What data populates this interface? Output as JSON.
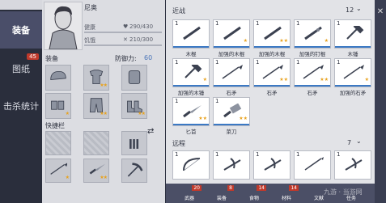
{
  "nav": {
    "equip_label": "装备",
    "blueprint_label": "图纸",
    "blueprint_badge": "45",
    "kills_label": "击杀统计"
  },
  "character": {
    "name": "尼奥",
    "hp_label": "健康",
    "hp_value": "290/430",
    "hunger_label": "饥饿",
    "hunger_value": "210/300",
    "equip_label": "装备",
    "defense_label": "防御力:",
    "defense_value": "60",
    "quickbar_label": "快捷栏"
  },
  "equip_slots": [
    {
      "icon": "cap-icon",
      "stars": ""
    },
    {
      "icon": "shirt-icon",
      "stars": "★★"
    },
    {
      "icon": "backpack-icon",
      "stars": ""
    },
    {
      "icon": "gloves-icon",
      "stars": "★"
    },
    {
      "icon": "pants-icon",
      "stars": "★★"
    },
    {
      "icon": "boots-icon",
      "stars": "★★"
    }
  ],
  "quick_slots": [
    {
      "icon": "empty-icon",
      "stars": ""
    },
    {
      "icon": "empty-icon",
      "stars": ""
    },
    {
      "icon": "ammo-icon",
      "stars": ""
    },
    {
      "icon": "spear-icon",
      "stars": "★"
    },
    {
      "icon": "knife-icon",
      "stars": "★★"
    },
    {
      "icon": "pickaxe-icon",
      "stars": ""
    }
  ],
  "inventory": {
    "melee_label": "近战",
    "melee_count": "12",
    "ranged_label": "远程",
    "ranged_count": "7",
    "melee": [
      {
        "count": "1",
        "name": "木棍",
        "stars": "",
        "icon": "stick-icon"
      },
      {
        "count": "1",
        "name": "加强的木棍",
        "stars": "★",
        "icon": "stick-icon"
      },
      {
        "count": "1",
        "name": "加强的木棍",
        "stars": "★★",
        "icon": "stick-icon"
      },
      {
        "count": "1",
        "name": "加强的钉棍",
        "stars": "★",
        "icon": "nail-bat-icon"
      },
      {
        "count": "1",
        "name": "木锤",
        "stars": "",
        "icon": "hammer-icon"
      },
      {
        "count": "1",
        "name": "加强的木锤",
        "stars": "★",
        "icon": "hammer-icon"
      },
      {
        "count": "1",
        "name": "石矛",
        "stars": "",
        "icon": "spear-icon"
      },
      {
        "count": "1",
        "name": "石矛",
        "stars": "★★",
        "icon": "spear-icon"
      },
      {
        "count": "1",
        "name": "石矛",
        "stars": "★★",
        "icon": "spear-icon"
      },
      {
        "count": "1",
        "name": "加强的石矛",
        "stars": "★",
        "icon": "spear-icon"
      },
      {
        "count": "1",
        "name": "匕首",
        "stars": "★★",
        "icon": "knife-icon"
      },
      {
        "count": "1",
        "name": "菜刀",
        "stars": "★★",
        "icon": "cleaver-icon"
      }
    ],
    "ranged": [
      {
        "count": "1",
        "icon": "bow-icon"
      },
      {
        "count": "1",
        "icon": "crossbow-icon"
      },
      {
        "count": "1",
        "icon": "crossbow-icon"
      },
      {
        "count": "1",
        "icon": "bolt-icon"
      },
      {
        "count": "1",
        "icon": "crossbow-icon"
      }
    ]
  },
  "bottom_tabs": [
    {
      "label": "武器",
      "count": "20"
    },
    {
      "label": "装备",
      "count": "8"
    },
    {
      "label": "食物",
      "count": "14"
    },
    {
      "label": "材料",
      "count": "14"
    },
    {
      "label": "文献",
      "count": ""
    },
    {
      "label": "任务",
      "count": ""
    }
  ],
  "watermark": "九游 · 当游网"
}
